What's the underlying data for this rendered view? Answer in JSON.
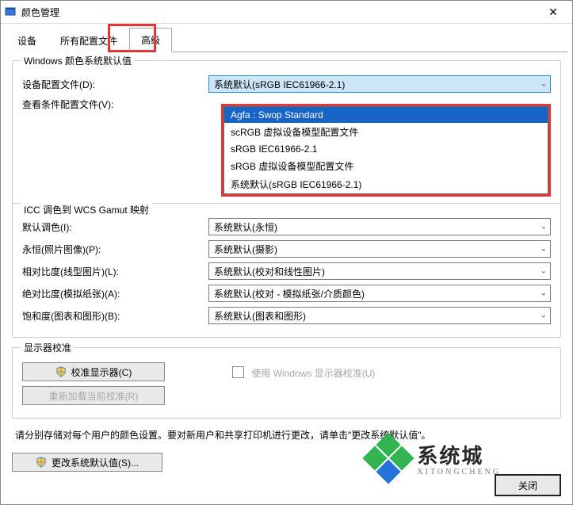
{
  "window": {
    "title": "颜色管理"
  },
  "tabs": {
    "t0": "设备",
    "t1": "所有配置文件",
    "t2": "高级"
  },
  "group_defaults": {
    "title": "Windows 颜色系统默认值",
    "device_profile_label": "设备配置文件(D):",
    "device_profile_value": "系统默认(sRGB IEC61966-2.1)",
    "viewing_label": "查看条件配置文件(V):",
    "dropdown": {
      "i0": "Agfa : Swop Standard",
      "i1": "scRGB 虚拟设备模型配置文件",
      "i2": "sRGB IEC61966-2.1",
      "i3": "sRGB 虚拟设备模型配置文件",
      "i4": "系统默认(sRGB IEC61966-2.1)"
    }
  },
  "group_icc": {
    "title": "ICC 调色到 WCS Gamut 映射",
    "default_tone_label": "默认调色(I):",
    "default_tone_value": "系统默认(永恒)",
    "perceptual_label": "永恒(照片图像)(P):",
    "perceptual_value": "系统默认(摄影)",
    "relative_label": "相对比度(线型图片)(L):",
    "relative_value": "系统默认(校对和线性图片)",
    "absolute_label": "绝对比度(模拟纸张)(A):",
    "absolute_value": "系统默认(校对 - 模拟纸张/介质颜色)",
    "saturation_label": "饱和度(图表和图形)(B):",
    "saturation_value": "系统默认(图表和图形)"
  },
  "group_display": {
    "title": "显示器校准",
    "calibrate_btn": "校准显示器(C)",
    "reload_btn": "重新加载当前校准(R)",
    "use_windows_label": "使用 Windows 显示器校准(U)"
  },
  "instructions": "请分别存储对每个用户的颜色设置。要对新用户和共享打印机进行更改，请单击\"更改系统默认值\"。",
  "change_defaults_btn": "更改系统默认值(S)...",
  "close_btn": "关闭",
  "watermark": {
    "cn": "系统城",
    "en": "XITONGCHENG"
  }
}
